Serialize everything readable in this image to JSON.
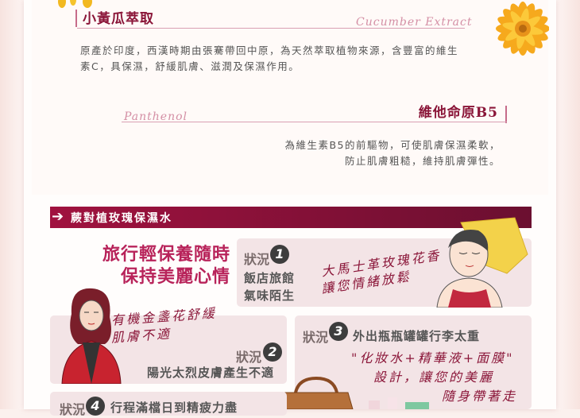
{
  "ingredients": {
    "cucumber": {
      "title": "小黃瓜萃取",
      "script_name": "Cucumber Extract",
      "description": "原產於印度，西漢時期由張騫帶回中原，為天然萃取植物來源，含豐富的維生素C，具保濕，舒緩肌膚、滋潤及保濕作用。"
    },
    "panthenol": {
      "title": "維他命原B5",
      "script_name": "Panthenol",
      "description_line1": "為維生素B5的前驅物，可使肌膚保濕柔軟，",
      "description_line2": "防止肌膚粗糙，維持肌膚彈性。"
    }
  },
  "section": {
    "arrow": "➔",
    "title": "蕨對植玫瑰保濕水"
  },
  "headline": {
    "line1": "旅行輕保養隨時",
    "line2": "保持美麗心情"
  },
  "cases": {
    "case_label": "狀況",
    "case1": {
      "num": "1",
      "line1": "飯店旅館",
      "line2": "氣味陌生",
      "hand_line1": "大馬士革玫瑰花香",
      "hand_line2": "讓您情緒放鬆"
    },
    "case2": {
      "num": "2",
      "text": "陽光太烈皮膚產生不適",
      "hand_line1": "有機金盞花舒緩",
      "hand_line2": "肌膚不適"
    },
    "case3": {
      "num": "3",
      "text": "外出瓶瓶罐罐行李太重",
      "hand_line1": "\"化妝水+精華液+面膜\"",
      "hand_line2": "設計，讓您的美麗",
      "hand_line3": "隨身帶著走"
    },
    "case4": {
      "num": "4",
      "text": "行程滿檔日到精疲力盡"
    }
  },
  "colors": {
    "accent": "#8a1538",
    "header": "#a0123f",
    "box": "#f3e4e6"
  }
}
